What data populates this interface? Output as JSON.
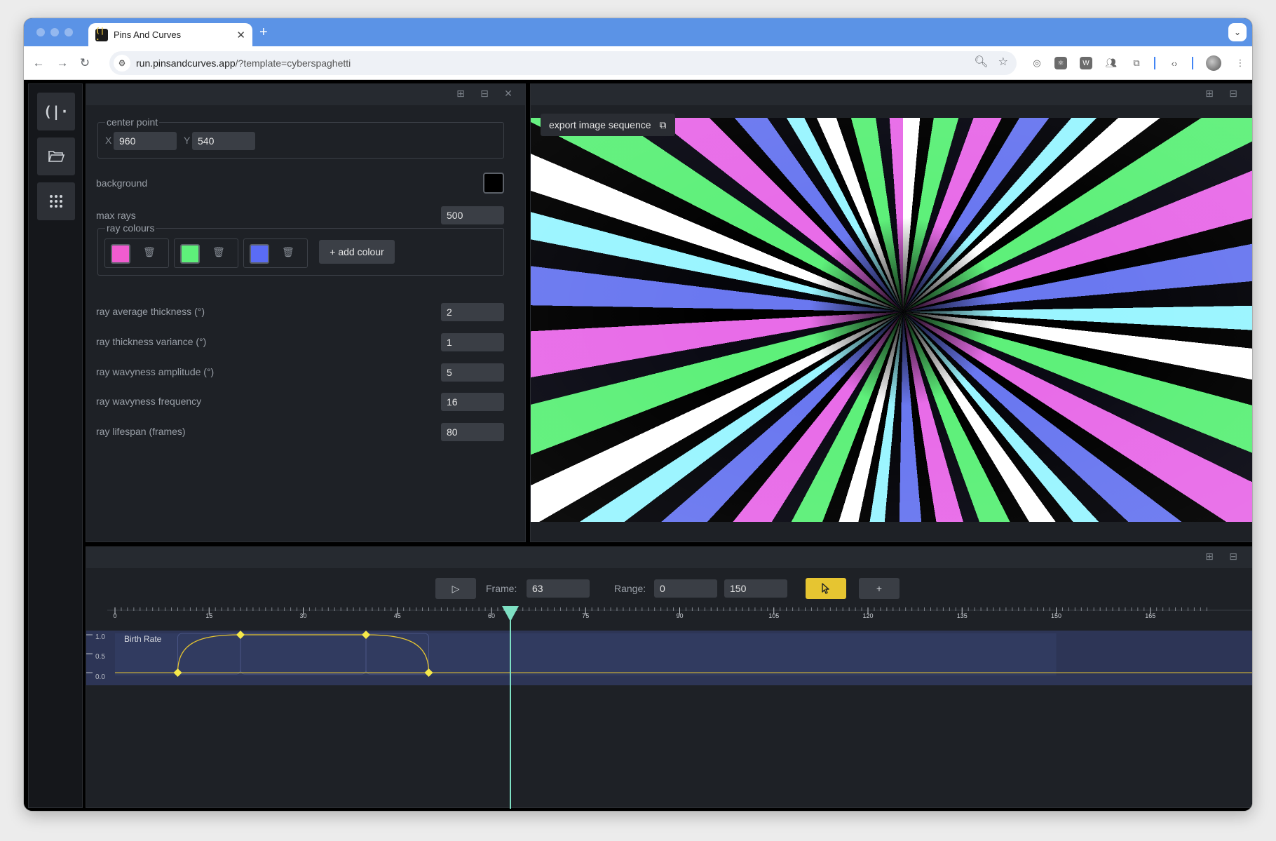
{
  "browser": {
    "tab_title": "Pins And Curves",
    "new_tab": "+",
    "url_host": "run.pinsandcurves.app",
    "url_rest": "/?template=cyberspaghetti"
  },
  "props": {
    "center_point": {
      "legend": "center point",
      "x_label": "X",
      "x_value": "960",
      "y_label": "Y",
      "y_value": "540"
    },
    "background_label": "background",
    "background_color": "#000000",
    "max_rays_label": "max rays",
    "max_rays_value": "500",
    "ray_colours_legend": "ray colours",
    "ray_colours": [
      "#f05cd0",
      "#5ef07a",
      "#5a6cf5"
    ],
    "add_colour_label": "+ add colour",
    "fields": [
      {
        "label": "ray average thickness (°)",
        "value": "2"
      },
      {
        "label": "ray thickness variance (°)",
        "value": "1"
      },
      {
        "label": "ray wavyness amplitude (°)",
        "value": "5"
      },
      {
        "label": "ray wavyness frequency",
        "value": "16"
      },
      {
        "label": "ray lifespan (frames)",
        "value": "80"
      }
    ]
  },
  "preview": {
    "export_label": "export image sequence"
  },
  "timeline": {
    "frame_label": "Frame:",
    "frame_value": "63",
    "range_label": "Range:",
    "range_start": "0",
    "range_end": "150",
    "ticks": [
      "0",
      "15",
      "30",
      "45",
      "60",
      "75",
      "90",
      "105",
      "120",
      "135",
      "150",
      "165"
    ],
    "track": {
      "name": "Birth Rate",
      "y_labels": [
        "1.0",
        "0.5",
        "0.0"
      ],
      "keyframes": [
        {
          "frame": 10,
          "value": 0.0
        },
        {
          "frame": 20,
          "value": 1.0
        },
        {
          "frame": 40,
          "value": 1.0
        },
        {
          "frame": 50,
          "value": 0.0
        }
      ]
    },
    "playhead_frame": 63,
    "accent_color": "#e6c531",
    "playhead_color": "#7ee0c3"
  }
}
